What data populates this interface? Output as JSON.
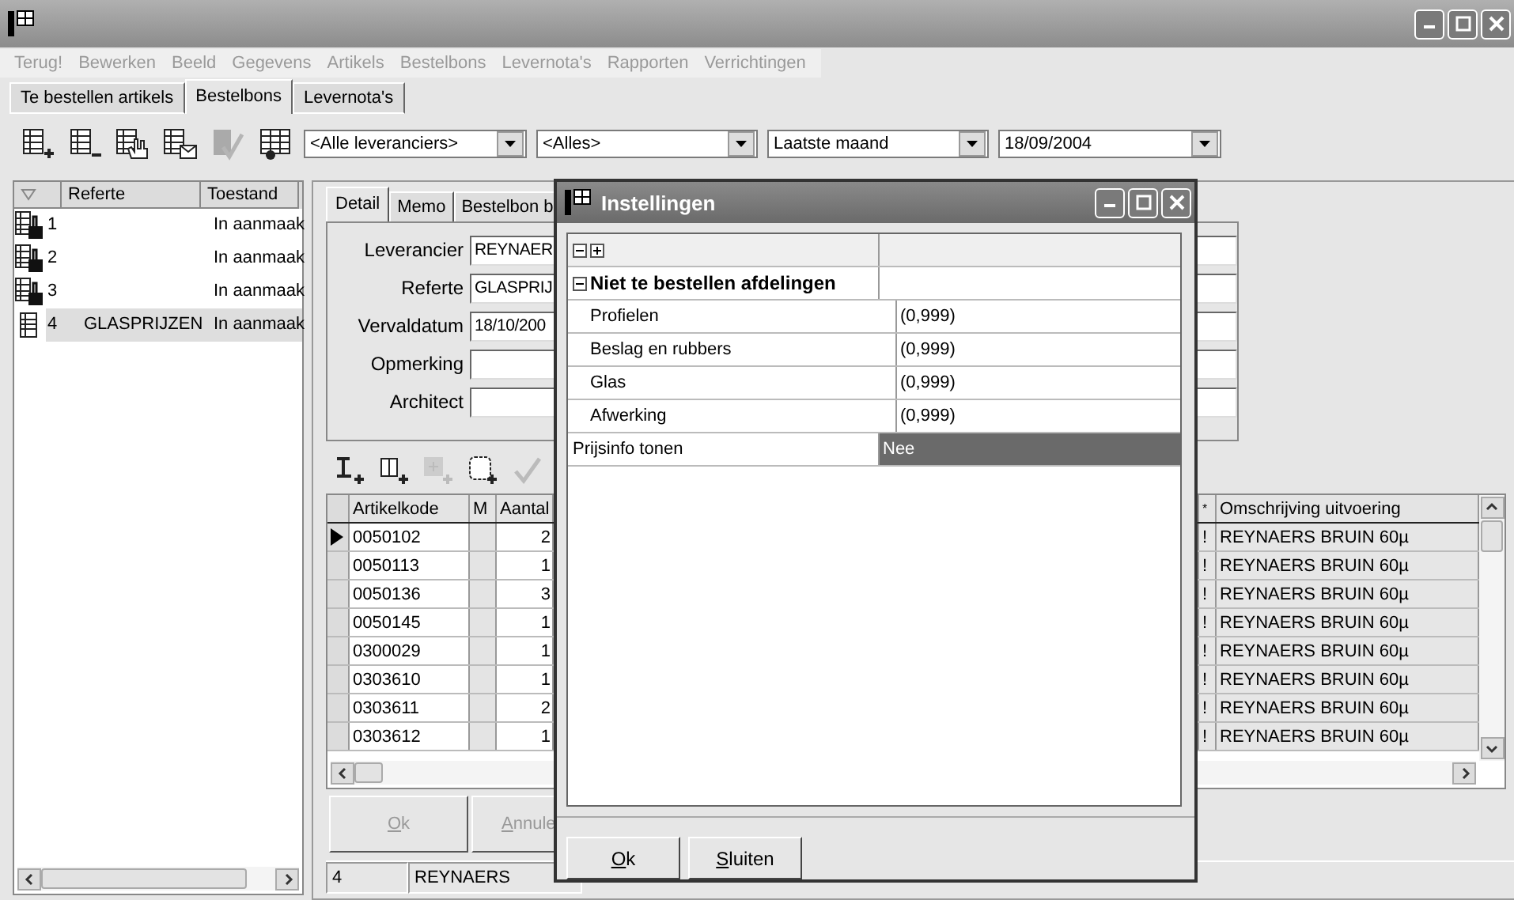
{
  "menu": [
    {
      "label": "Terug!",
      "disabled": true
    },
    {
      "label": "Bewerken",
      "disabled": true
    },
    {
      "label": "Beeld",
      "disabled": true
    },
    {
      "label": "Gegevens",
      "disabled": true
    },
    {
      "label": "Artikels",
      "disabled": true
    },
    {
      "label": "Bestelbons",
      "disabled": true
    },
    {
      "label": "Levernota's",
      "disabled": true
    },
    {
      "label": "Rapporten",
      "disabled": true
    },
    {
      "label": "Verrichtingen",
      "disabled": true
    }
  ],
  "tabs": [
    {
      "label": "Te bestellen artikels",
      "selected": false
    },
    {
      "label": "Bestelbons",
      "selected": true
    },
    {
      "label": "Levernota's",
      "selected": false
    }
  ],
  "toolbar": [
    {
      "disabled": false
    },
    {
      "disabled": false
    },
    {
      "disabled": false
    },
    {
      "disabled": false
    },
    {
      "disabled": true
    },
    {
      "disabled": false
    }
  ],
  "filters": [
    {
      "value": "<Alle leveranciers>"
    },
    {
      "value": "<Alles>"
    },
    {
      "value": "Laatste maand"
    },
    {
      "value": "18/09/2004"
    }
  ],
  "order_list": {
    "columns": [
      "Referte",
      "Toestand"
    ],
    "rows": [
      {
        "kind": "locked",
        "number": "1",
        "toestand": "In aanmaak",
        "selected": false
      },
      {
        "kind": "locked",
        "number": "2",
        "toestand": "In aanmaak",
        "selected": false
      },
      {
        "kind": "locked",
        "number": "3",
        "toestand": "In aanmaak",
        "selected": false
      },
      {
        "kind": "plain",
        "number": "4",
        "referte": "GLASPRIJZEN",
        "toestand": "In aanmaak",
        "selected": true
      }
    ]
  },
  "detail_tabs": [
    {
      "label": "Detail",
      "selected": true
    },
    {
      "label": "Memo",
      "selected": false
    },
    {
      "label": "Bestelbon b",
      "selected": false
    }
  ],
  "fields": [
    {
      "label": "Leverancier",
      "value": "REYNAER"
    },
    {
      "label": "Referte",
      "value": "GLASPRIJ"
    },
    {
      "label": "Vervaldatum",
      "value": "18/10/200"
    },
    {
      "label": "Opmerking"
    },
    {
      "label": "Architect"
    }
  ],
  "grid_toolbar": [
    {
      "disabled": false
    },
    {
      "disabled": false
    },
    {
      "disabled": true
    },
    {
      "disabled": false
    },
    {
      "disabled": true
    }
  ],
  "grid": {
    "columns": [
      "Artikelkode",
      "M",
      "Aantal",
      "*",
      "Omschrijving uitvoering"
    ],
    "rows": [
      {
        "code": "0050102",
        "aantal": "2",
        "flag": "!",
        "description": "REYNAERS BRUIN 60µ",
        "selected": true
      },
      {
        "code": "0050113",
        "aantal": "1",
        "flag": "!",
        "description": "REYNAERS BRUIN 60µ",
        "selected": false
      },
      {
        "code": "0050136",
        "aantal": "3",
        "flag": "!",
        "description": "REYNAERS BRUIN 60µ",
        "selected": false
      },
      {
        "code": "0050145",
        "aantal": "1",
        "flag": "!",
        "description": "REYNAERS BRUIN 60µ",
        "selected": false
      },
      {
        "code": "0300029",
        "aantal": "1",
        "flag": "!",
        "description": "REYNAERS BRUIN 60µ",
        "selected": false
      },
      {
        "code": "0303610",
        "aantal": "1",
        "flag": "!",
        "description": "REYNAERS BRUIN 60µ",
        "selected": false
      },
      {
        "code": "0303611",
        "aantal": "2",
        "flag": "!",
        "description": "REYNAERS BRUIN 60µ",
        "selected": false
      },
      {
        "code": "0303612",
        "aantal": "1",
        "flag": "!",
        "description": "REYNAERS BRUIN 60µ",
        "selected": false
      }
    ]
  },
  "buttons": [
    {
      "label": "Ok",
      "disabled": true
    },
    {
      "label": "Annule",
      "disabled": true
    }
  ],
  "status_bar": [
    "4",
    "REYNAERS"
  ],
  "dialog": {
    "title": "Instellingen",
    "category": {
      "label": "Niet te bestellen afdelingen",
      "expanded": true,
      "children": [
        {
          "label": "Profielen",
          "value": "(0,999)"
        },
        {
          "label": "Beslag en rubbers",
          "value": "(0,999)"
        },
        {
          "label": "Glas",
          "value": "(0,999)"
        },
        {
          "label": "Afwerking",
          "value": "(0,999)"
        }
      ]
    },
    "properties": [
      {
        "label": "Prijsinfo tonen",
        "value": "Nee",
        "selected": true
      }
    ],
    "buttons": [
      {
        "label": "Ok"
      },
      {
        "label": "Sluiten"
      }
    ]
  }
}
